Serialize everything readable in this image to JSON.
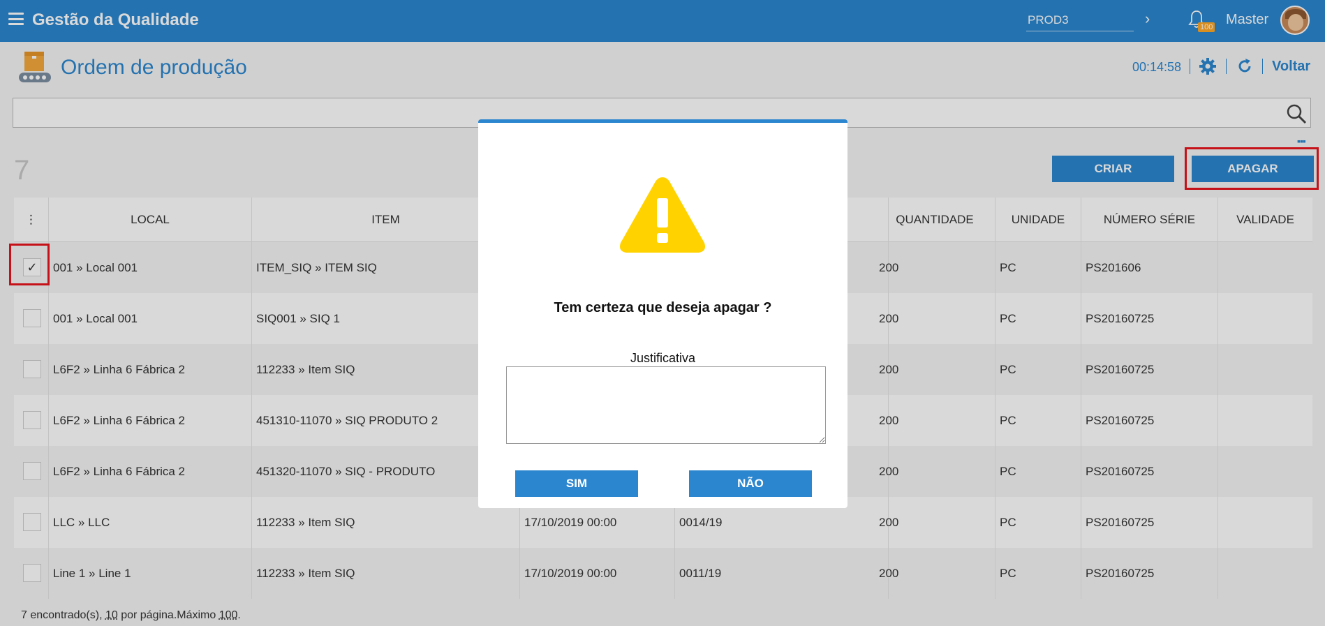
{
  "header": {
    "app_title": "Gestão da Qualidade",
    "environment": "PROD3",
    "notifications_count": "100",
    "user_name": "Master"
  },
  "page": {
    "title": "Ordem de produção",
    "timer": "00:14:58",
    "back_label": "Voltar"
  },
  "toolbar": {
    "record_count": "7",
    "create_label": "CRIAR",
    "delete_label": "APAGAR"
  },
  "table": {
    "menu_glyph": "⋮",
    "columns": {
      "local": "LOCAL",
      "item": "ITEM",
      "quantidade": "QUANTIDADE",
      "unidade": "UNIDADE",
      "numero_serie": "NÚMERO SÉRIE",
      "validade": "VALIDADE"
    },
    "rows": [
      {
        "checked": "✓",
        "local": "001 » Local 001",
        "item": "ITEM_SIQ » ITEM SIQ",
        "data": "",
        "ordem": "",
        "quantidade": "200",
        "unidade": "PC",
        "serie": "PS201606",
        "validade": ""
      },
      {
        "checked": "",
        "local": "001 » Local 001",
        "item": "SIQ001 » SIQ 1",
        "data": "",
        "ordem": "",
        "quantidade": "200",
        "unidade": "PC",
        "serie": "PS20160725",
        "validade": ""
      },
      {
        "checked": "",
        "local": "L6F2 » Linha 6 Fábrica 2",
        "item": "112233 » Item SIQ",
        "data": "",
        "ordem": "",
        "quantidade": "200",
        "unidade": "PC",
        "serie": "PS20160725",
        "validade": ""
      },
      {
        "checked": "",
        "local": "L6F2 » Linha 6 Fábrica 2",
        "item": "451310-11070 » SIQ PRODUTO 2",
        "data": "",
        "ordem": "",
        "quantidade": "200",
        "unidade": "PC",
        "serie": "PS20160725",
        "validade": ""
      },
      {
        "checked": "",
        "local": "L6F2 » Linha 6 Fábrica 2",
        "item": "451320-11070 » SIQ - PRODUTO",
        "data": "",
        "ordem": "",
        "quantidade": "200",
        "unidade": "PC",
        "serie": "PS20160725",
        "validade": ""
      },
      {
        "checked": "",
        "local": "LLC » LLC",
        "item": "112233 » Item SIQ",
        "data": "17/10/2019 00:00",
        "ordem": "0014/19",
        "quantidade": "200",
        "unidade": "PC",
        "serie": "PS20160725",
        "validade": ""
      },
      {
        "checked": "",
        "local": "Line 1 » Line 1",
        "item": "112233 » Item SIQ",
        "data": "17/10/2019 00:00",
        "ordem": "0011/19",
        "quantidade": "200",
        "unidade": "PC",
        "serie": "PS20160725",
        "validade": ""
      }
    ]
  },
  "footer": {
    "found": "7 encontrado(s), ",
    "per_page": "10",
    "per_page_text": " por página.Máximo ",
    "max": "100",
    "end": "."
  },
  "dialog": {
    "title": "Tem certeza que deseja apagar ?",
    "justification_label": "Justificativa",
    "justification_value": "",
    "yes_label": "SIM",
    "no_label": "NÃO"
  },
  "colors": {
    "primary": "#2b86cf",
    "warning": "#ffd200",
    "highlight": "#e8141c"
  }
}
